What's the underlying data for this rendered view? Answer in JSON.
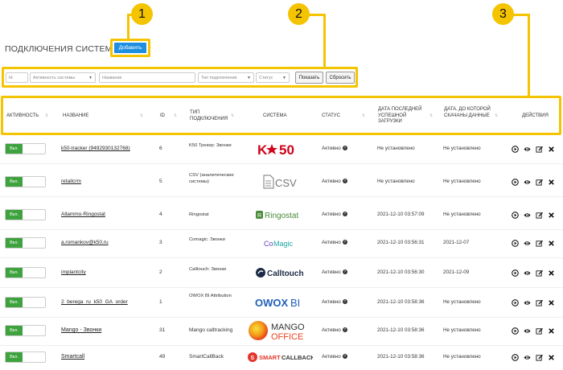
{
  "page": {
    "title": "ПОДКЛЮЧЕНИЯ СИСТЕМ",
    "add_label": "Добавить"
  },
  "callouts": [
    "1",
    "2",
    "3"
  ],
  "filters": {
    "id_placeholder": "Id",
    "activity_placeholder": "Активность системы",
    "name_placeholder": "Название",
    "type_placeholder": "Тип подключения",
    "status_placeholder": "Статус",
    "show_label": "Показать",
    "reset_label": "Сбросить"
  },
  "columns": {
    "activity": "АКТИВНОСТЬ",
    "name": "НАЗВАНИЕ",
    "id": "ID",
    "type": "ТИП ПОДКЛЮЧЕНИЯ",
    "system": "СИСТЕМА",
    "status": "СТАТУС",
    "last_load": "ДАТА ПОСЛЕДНЕЙ УСПЕШНОЙ ЗАГРУЗКИ",
    "downloaded_until": "ДАТА, ДО КОТОРОЙ СКАЧАНЫ ДАННЫЕ",
    "actions": "ДЕЙСТВИЯ"
  },
  "toggle_label": "Вкл.",
  "status_icon": "question-circle-icon",
  "rows": [
    {
      "name": "k50-tracker (9492930132768)",
      "id": "6",
      "type": "K50 Трекер: Звонки",
      "system": "K50",
      "status": "Активно",
      "last_load": "Не установлено",
      "until": "Не установлено"
    },
    {
      "name": "retailcrm",
      "id": "5",
      "type": "CSV (аналитические системы)",
      "system": "CSV",
      "status": "Активно",
      "last_load": "Не установлено",
      "until": "Не установлено"
    },
    {
      "name": "Allammo-Ringostat",
      "id": "4",
      "type": "Ringostat",
      "system": "Ringostat",
      "status": "Активно",
      "last_load": "2021-12-10 03:57:09",
      "until": "Не установлено"
    },
    {
      "name": "a.romankov@k50.ru",
      "id": "3",
      "type": "Comagic: Звонки",
      "system": "CoMagic",
      "status": "Активно",
      "last_load": "2021-12-10 03:56:31",
      "until": "2021-12-07"
    },
    {
      "name": "implantcity",
      "id": "2",
      "type": "Calltouch: Звонки",
      "system": "Calltouch",
      "status": "Активно",
      "last_load": "2021-12-10 03:56:30",
      "until": "2021-12-09"
    },
    {
      "name": "2_beregа_ru_k50_GA_order",
      "id": "1",
      "type": "OWOX BI Attribution",
      "system": "OWOX BI",
      "status": "Активно",
      "last_load": "2021-12-10 03:58:36",
      "until": "Не установлено"
    },
    {
      "name": "Mango - Звонки",
      "id": "31",
      "type": "Mango calltracking",
      "system": "MANGO OFFICE",
      "status": "Активно",
      "last_load": "2021-12-10 03:58:36",
      "until": "Не установлено"
    },
    {
      "name": "Smartcall",
      "id": "49",
      "type": "SmartCallBack",
      "system": "SMARTCALLBACK",
      "status": "Активно",
      "last_load": "2021-12-10 03:58:36",
      "until": "Не установлено"
    }
  ],
  "action_icons": [
    "play-circle-icon",
    "eye-icon",
    "edit-icon",
    "close-icon"
  ],
  "colors": {
    "accent": "#f5c400",
    "primary": "#1e8fe0",
    "toggle_on": "#3ea33e"
  }
}
